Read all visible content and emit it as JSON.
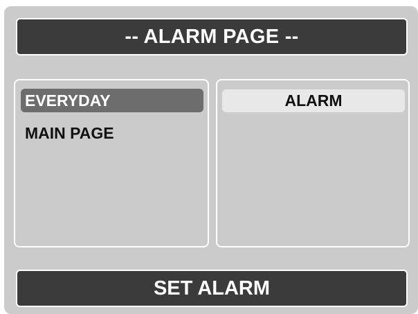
{
  "header": {
    "title": "-- ALARM PAGE --"
  },
  "left_panel": {
    "items": [
      {
        "label": "EVERYDAY",
        "selected": true
      },
      {
        "label": "MAIN PAGE",
        "selected": false
      }
    ]
  },
  "right_panel": {
    "items": [
      {
        "label": "ALARM"
      }
    ]
  },
  "footer": {
    "button_label": "SET ALARM"
  },
  "colors": {
    "screen_background": "#cbcbcb",
    "bar_background": "#3b3b3b",
    "selected_item": "#6d6d6d",
    "alarm_cell": "#e8e8e8",
    "border": "#ffffff"
  }
}
